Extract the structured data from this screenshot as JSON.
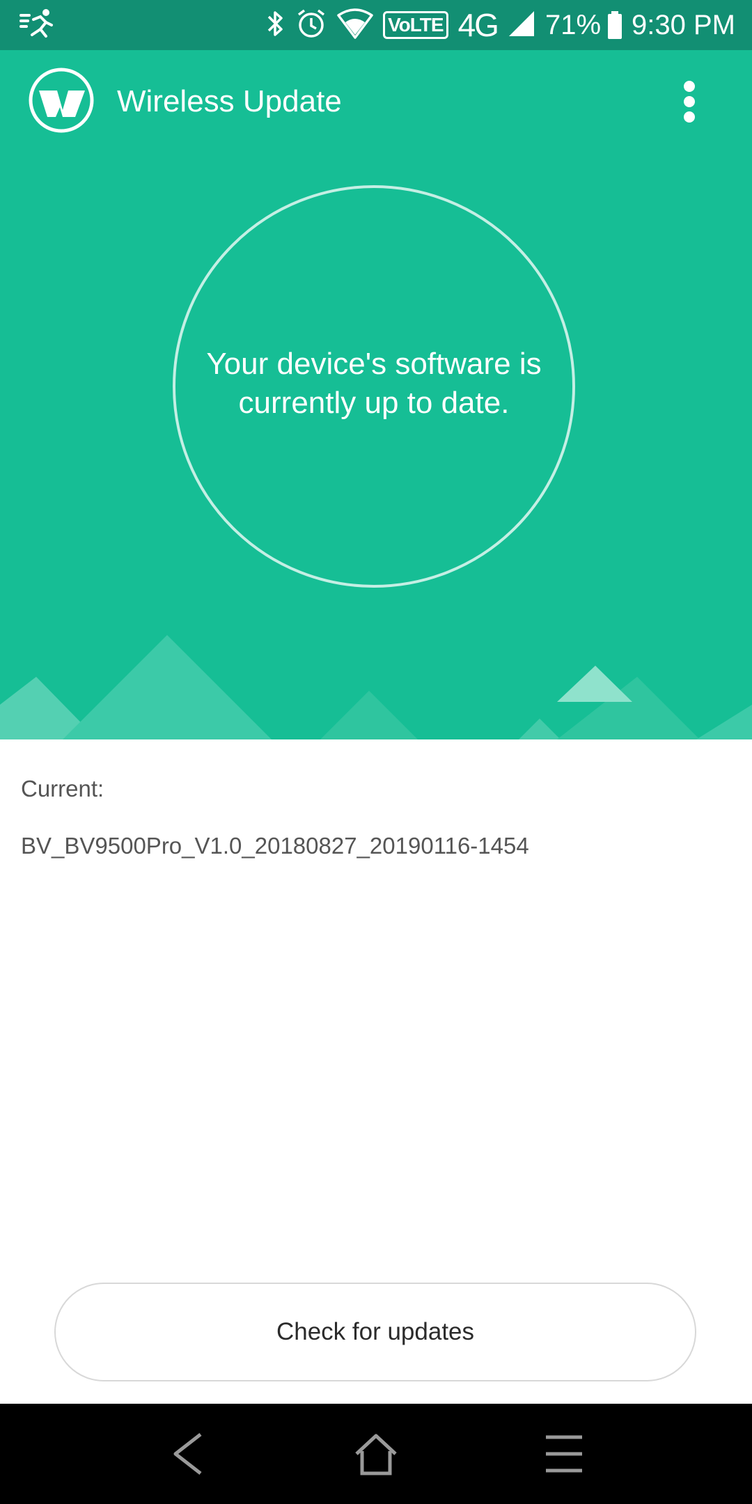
{
  "status_bar": {
    "battery_percent": "71%",
    "time": "9:30 PM",
    "volte": "VoLTE",
    "network": "4G",
    "icons": [
      "activity-icon",
      "bluetooth-icon",
      "alarm-icon",
      "wifi-icon",
      "signal-icon",
      "battery-icon"
    ]
  },
  "app_bar": {
    "title": "Wireless Update",
    "logo_icon": "wireless-update-logo",
    "menu_icon": "more-vert-icon"
  },
  "status": {
    "message": "Your device's software is currently up to date."
  },
  "details": {
    "current_label": "Current:",
    "current_version": "BV_BV9500Pro_V1.0_20180827_20190116-1454"
  },
  "actions": {
    "check_label": "Check for updates"
  },
  "nav_bar": {
    "icons": [
      "back-icon",
      "home-icon",
      "recents-icon"
    ]
  },
  "colors": {
    "status_bar": "#128f73",
    "hero": "#16be95",
    "nav_bar": "#000000"
  }
}
